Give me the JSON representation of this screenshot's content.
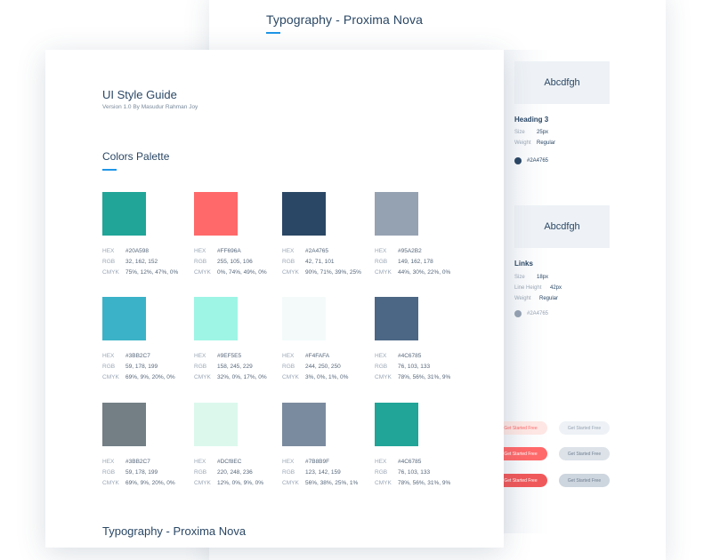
{
  "back_sheet": {
    "title": "Typography - Proxima Nova",
    "heading3_card": {
      "sample": "Abcdfgh"
    },
    "heading3": {
      "title": "Heading 3",
      "size_label": "Size",
      "size_value": "25px",
      "weight_label": "Weight",
      "weight_value": "Regular",
      "swatch_color": "#2A4765",
      "swatch_hex": "#2A4765"
    },
    "links_card": {
      "sample": "Abcdfgh"
    },
    "links": {
      "title": "Links",
      "size_label": "Size",
      "size_value": "18px",
      "line_height_label": "Line Height",
      "line_height_value": "42px",
      "weight_label": "Weight",
      "weight_value": "Regular",
      "swatch_color": "#95A2B2",
      "swatch_hex": "#2A4765"
    },
    "buttons": [
      {
        "label": "Get Started Free",
        "style": "coral-light",
        "bg": "#FDE6E3",
        "fg": "#FF696A"
      },
      {
        "label": "Get Started Free",
        "style": "gray-light",
        "bg": "#EEF2F6",
        "fg": "#95A2B2"
      },
      {
        "label": "Get Started Free",
        "style": "coral",
        "bg": "#FF696A",
        "fg": "#ffffff"
      },
      {
        "label": "Get Started Free",
        "style": "gray",
        "bg": "#DCE2E8",
        "fg": "#6f7f92"
      },
      {
        "label": "Get Started Free",
        "style": "coral-dark",
        "bg": "#F0595B",
        "fg": "#ffffff"
      },
      {
        "label": "Get Started Free",
        "style": "gray-dark",
        "bg": "#CDD5DE",
        "fg": "#6f7f92"
      }
    ]
  },
  "front_sheet": {
    "title": "UI Style Guide",
    "subtitle": "Version 1.0  By Masudur Rahman Joy",
    "section_title": "Colors Palette",
    "labels": {
      "hex": "HEX",
      "rgb": "RGB",
      "cmyk": "CMYK"
    },
    "colors": [
      {
        "hex": "#20A598",
        "rgb": "32, 162, 152",
        "cmyk": "75%, 12%, 47%, 0%"
      },
      {
        "hex": "#FF696A",
        "rgb": "255, 105, 106",
        "cmyk": "0%, 74%, 49%, 0%"
      },
      {
        "hex": "#2A4765",
        "rgb": "42, 71, 101",
        "cmyk": "90%, 71%, 39%, 25%"
      },
      {
        "hex": "#95A2B2",
        "rgb": "149, 162, 178",
        "cmyk": "44%, 30%, 22%, 0%"
      },
      {
        "hex": "#3BB2C7",
        "rgb": "59, 178, 199",
        "cmyk": "69%, 9%, 20%, 0%"
      },
      {
        "hex": "#9EF5E5",
        "rgb": "158, 245, 229",
        "cmyk": "32%, 0%, 17%, 0%"
      },
      {
        "hex": "#F4FAFA",
        "rgb": "244, 250, 250",
        "cmyk": "3%, 0%, 1%, 0%"
      },
      {
        "hex": "#4C6785",
        "rgb": "76, 103, 133",
        "cmyk": "78%, 56%, 31%, 9%"
      },
      {
        "hex": "#3BB2C7",
        "swatch": "#737F85",
        "rgb": "59, 178, 199",
        "cmyk": "69%, 9%, 20%, 0%"
      },
      {
        "hex": "#DCf8EC",
        "swatch": "#DCF8EC",
        "rgb": "220, 248, 236",
        "cmyk": "12%, 0%, 9%, 0%"
      },
      {
        "hex": "#7B8B9F",
        "rgb": "123, 142, 159",
        "cmyk": "56%, 38%, 25%, 1%"
      },
      {
        "hex": "#4C6785",
        "swatch": "#20A598",
        "rgb": "76, 103, 133",
        "cmyk": "78%, 56%, 31%, 9%"
      }
    ],
    "bottom_title": "Typography - Proxima Nova"
  }
}
